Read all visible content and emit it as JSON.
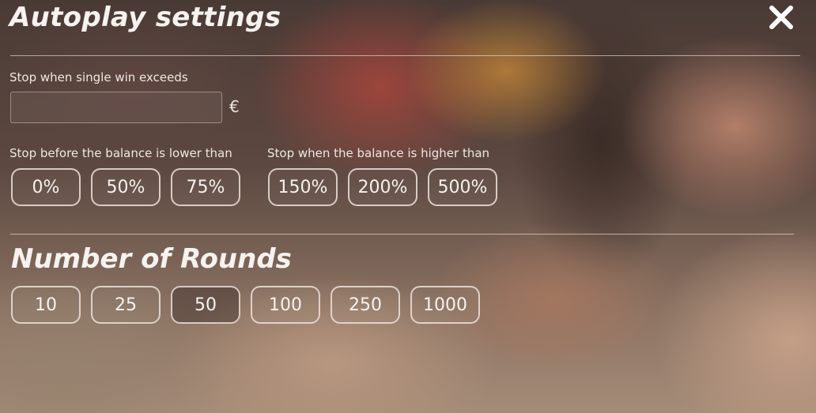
{
  "header": {
    "title": "Autoplay settings"
  },
  "single_win": {
    "label": "Stop when single win exceeds",
    "value": "",
    "placeholder": "",
    "currency": "€"
  },
  "balance_lower": {
    "label": "Stop before the balance is lower than",
    "options": [
      "0%",
      "50%",
      "75%"
    ]
  },
  "balance_higher": {
    "label": "Stop when the balance is higher than",
    "options": [
      "150%",
      "200%",
      "500%"
    ]
  },
  "rounds": {
    "title": "Number of Rounds",
    "options": [
      "10",
      "25",
      "50",
      "100",
      "250",
      "1000"
    ],
    "selected": "50"
  },
  "icons": {
    "close": "close-icon"
  },
  "colors": {
    "text": "#f6f2ef",
    "pill_border": "#ebe1dc"
  }
}
